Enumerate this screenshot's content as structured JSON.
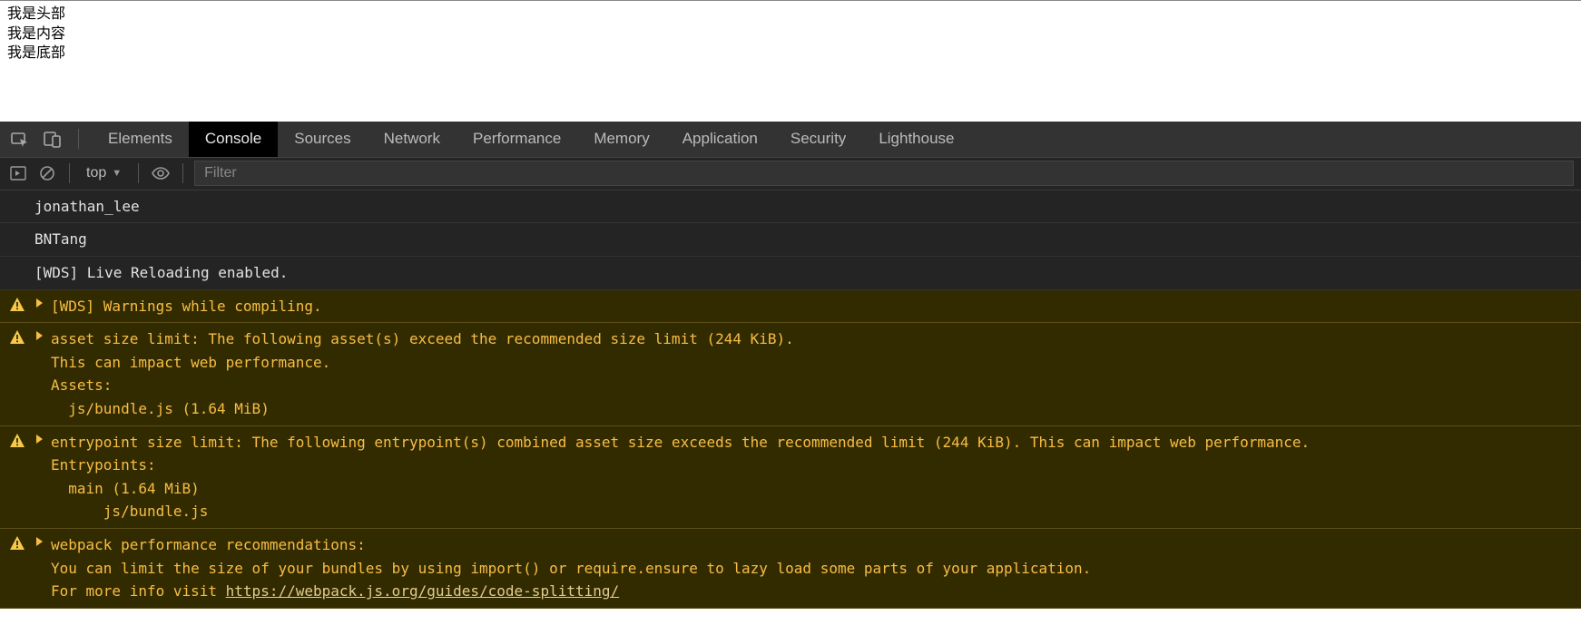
{
  "page": {
    "lines": [
      "我是头部",
      "我是内容",
      "我是底部"
    ]
  },
  "devtools": {
    "tabs": [
      "Elements",
      "Console",
      "Sources",
      "Network",
      "Performance",
      "Memory",
      "Application",
      "Security",
      "Lighthouse"
    ],
    "active_tab": "Console",
    "toolbar": {
      "context": "top",
      "filter_placeholder": "Filter"
    },
    "logs": [
      {
        "type": "log",
        "text": "jonathan_lee"
      },
      {
        "type": "log",
        "text": "BNTang"
      },
      {
        "type": "log",
        "text": "[WDS] Live Reloading enabled."
      },
      {
        "type": "warn",
        "expandable": true,
        "text": "[WDS] Warnings while compiling."
      },
      {
        "type": "warn",
        "expandable": true,
        "text": "asset size limit: The following asset(s) exceed the recommended size limit (244 KiB).\nThis can impact web performance.\nAssets:\n  js/bundle.js (1.64 MiB)"
      },
      {
        "type": "warn",
        "expandable": true,
        "text": "entrypoint size limit: The following entrypoint(s) combined asset size exceeds the recommended limit (244 KiB). This can impact web performance.\nEntrypoints:\n  main (1.64 MiB)\n      js/bundle.js"
      },
      {
        "type": "warn",
        "expandable": true,
        "text": "webpack performance recommendations:\nYou can limit the size of your bundles by using import() or require.ensure to lazy load some parts of your application.\nFor more info visit ",
        "link": "https://webpack.js.org/guides/code-splitting/"
      }
    ]
  }
}
